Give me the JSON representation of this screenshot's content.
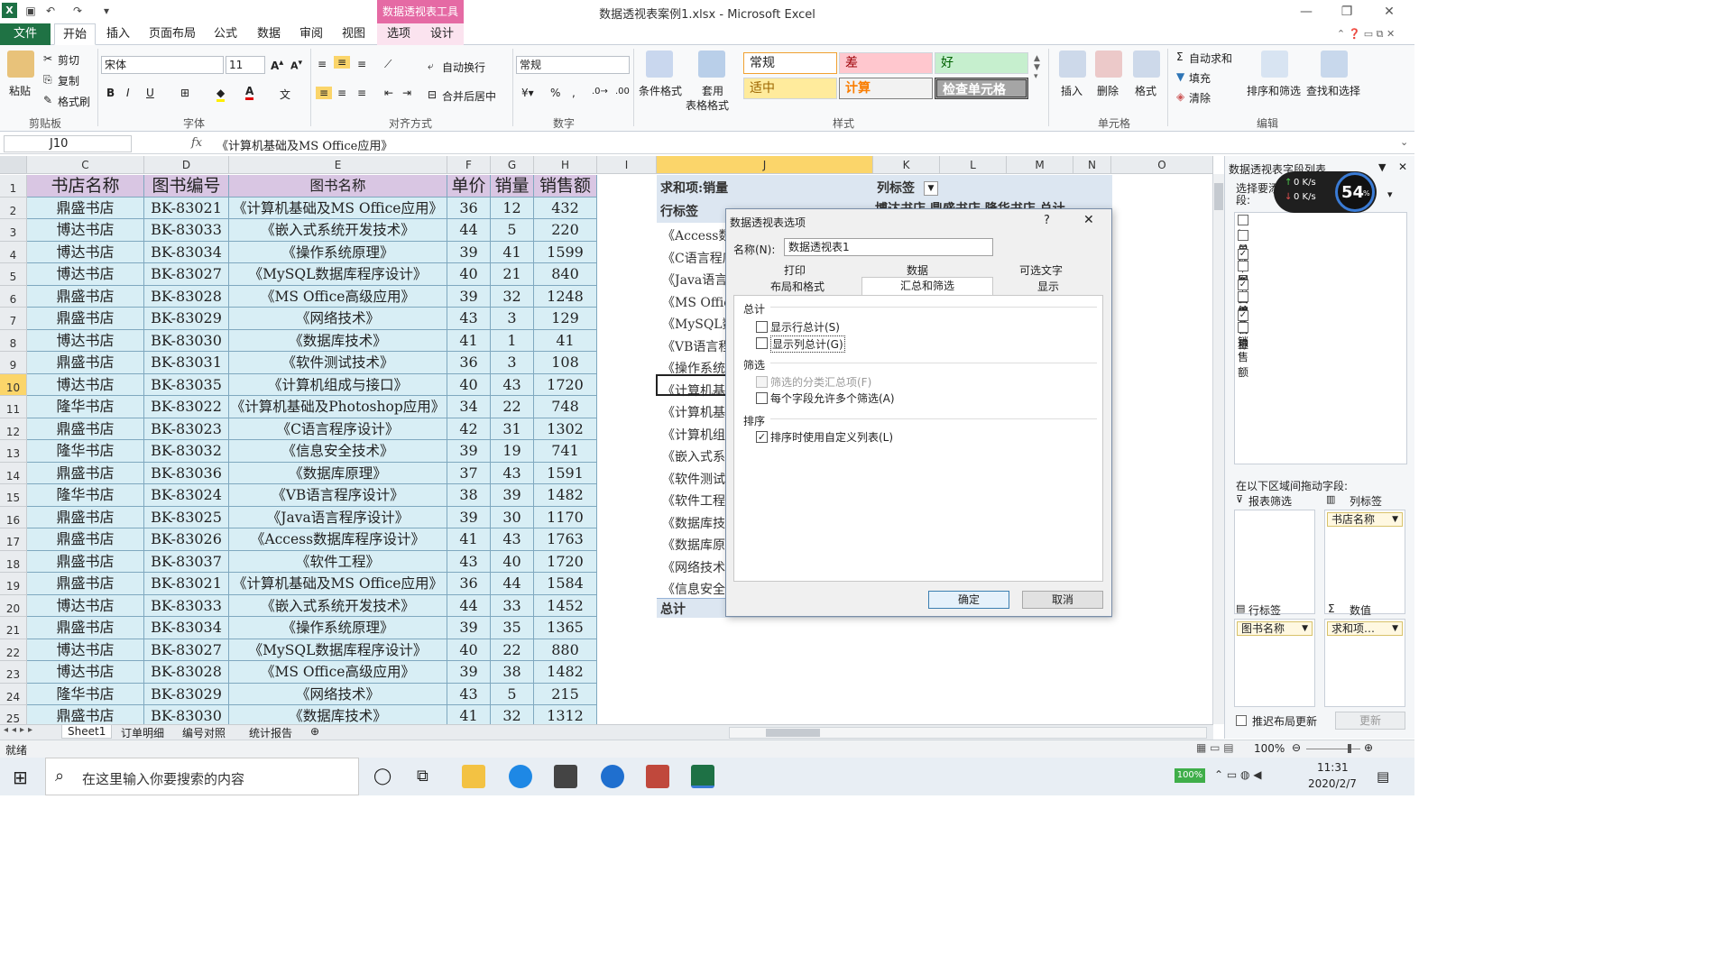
{
  "window": {
    "title": "数据透视表案例1.xlsx - Microsoft Excel",
    "context_tool": "数据透视表工具"
  },
  "tabs": [
    "文件",
    "开始",
    "插入",
    "页面布局",
    "公式",
    "数据",
    "审阅",
    "视图",
    "选项",
    "设计"
  ],
  "ribbon": {
    "clipboard": {
      "paste": "粘贴",
      "cut": "剪切",
      "copy": "复制",
      "format_painter": "格式刷",
      "label": "剪贴板"
    },
    "font": {
      "name": "宋体",
      "size": "11",
      "label": "字体"
    },
    "align": {
      "wrap": "自动换行",
      "merge": "合并后居中",
      "label": "对齐方式"
    },
    "number": {
      "format": "常规",
      "label": "数字"
    },
    "styles": {
      "cond": "条件格式",
      "table": "套用",
      "table2": "表格格式",
      "normal": "常规",
      "bad": "差",
      "good": "好",
      "neutral": "适中",
      "calc": "计算",
      "check": "检查单元格",
      "label": "样式"
    },
    "cells": {
      "insert": "插入",
      "delete": "删除",
      "format": "格式",
      "label": "单元格"
    },
    "editing": {
      "autosum": "自动求和",
      "fill": "填充",
      "clear": "清除",
      "sort": "排序和筛选",
      "find": "查找和选择",
      "label": "编辑"
    }
  },
  "formula_bar": {
    "name_box": "J10",
    "fx": "fx",
    "content": "《计算机基础及MS Office应用》"
  },
  "columns": [
    "C",
    "D",
    "E",
    "F",
    "G",
    "H",
    "I",
    "J",
    "K",
    "L",
    "M",
    "N",
    "O"
  ],
  "table": {
    "headers": [
      "书店名称",
      "图书编号",
      "图书名称",
      "单价",
      "销量",
      "销售额"
    ],
    "rows": [
      [
        "鼎盛书店",
        "BK-83021",
        "《计算机基础及MS Office应用》",
        "36",
        "12",
        "432"
      ],
      [
        "博达书店",
        "BK-83033",
        "《嵌入式系统开发技术》",
        "44",
        "5",
        "220"
      ],
      [
        "博达书店",
        "BK-83034",
        "《操作系统原理》",
        "39",
        "41",
        "1599"
      ],
      [
        "博达书店",
        "BK-83027",
        "《MySQL数据库程序设计》",
        "40",
        "21",
        "840"
      ],
      [
        "鼎盛书店",
        "BK-83028",
        "《MS Office高级应用》",
        "39",
        "32",
        "1248"
      ],
      [
        "鼎盛书店",
        "BK-83029",
        "《网络技术》",
        "43",
        "3",
        "129"
      ],
      [
        "博达书店",
        "BK-83030",
        "《数据库技术》",
        "41",
        "1",
        "41"
      ],
      [
        "鼎盛书店",
        "BK-83031",
        "《软件测试技术》",
        "36",
        "3",
        "108"
      ],
      [
        "博达书店",
        "BK-83035",
        "《计算机组成与接口》",
        "40",
        "43",
        "1720"
      ],
      [
        "隆华书店",
        "BK-83022",
        "《计算机基础及Photoshop应用》",
        "34",
        "22",
        "748"
      ],
      [
        "鼎盛书店",
        "BK-83023",
        "《C语言程序设计》",
        "42",
        "31",
        "1302"
      ],
      [
        "隆华书店",
        "BK-83032",
        "《信息安全技术》",
        "39",
        "19",
        "741"
      ],
      [
        "鼎盛书店",
        "BK-83036",
        "《数据库原理》",
        "37",
        "43",
        "1591"
      ],
      [
        "隆华书店",
        "BK-83024",
        "《VB语言程序设计》",
        "38",
        "39",
        "1482"
      ],
      [
        "鼎盛书店",
        "BK-83025",
        "《Java语言程序设计》",
        "39",
        "30",
        "1170"
      ],
      [
        "鼎盛书店",
        "BK-83026",
        "《Access数据库程序设计》",
        "41",
        "43",
        "1763"
      ],
      [
        "鼎盛书店",
        "BK-83037",
        "《软件工程》",
        "43",
        "40",
        "1720"
      ],
      [
        "鼎盛书店",
        "BK-83021",
        "《计算机基础及MS Office应用》",
        "36",
        "44",
        "1584"
      ],
      [
        "博达书店",
        "BK-83033",
        "《嵌入式系统开发技术》",
        "44",
        "33",
        "1452"
      ],
      [
        "鼎盛书店",
        "BK-83034",
        "《操作系统原理》",
        "39",
        "35",
        "1365"
      ],
      [
        "博达书店",
        "BK-83027",
        "《MySQL数据库程序设计》",
        "40",
        "22",
        "880"
      ],
      [
        "博达书店",
        "BK-83028",
        "《MS Office高级应用》",
        "39",
        "38",
        "1482"
      ],
      [
        "隆华书店",
        "BK-83029",
        "《网络技术》",
        "43",
        "5",
        "215"
      ],
      [
        "鼎盛书店",
        "BK-83030",
        "《数据库技术》",
        "41",
        "32",
        "1312"
      ]
    ]
  },
  "pivot": {
    "sum_label": "求和项:销量",
    "col_label": "列标签",
    "row_label": "行标签",
    "col_items_partial": "博达书店  鼎盛书店  隆华书店  总计",
    "rows": [
      "《Access数",
      "《C语言程序",
      "《Java语言",
      "《MS Offic",
      "《MySQL数",
      "《VB语言程",
      "《操作系统",
      "《计算机基",
      "《计算机基",
      "《计算机组",
      "《嵌入式系",
      "《软件测试",
      "《软件工程",
      "《数据库技",
      "《数据库原",
      "《网络技术",
      "《信息安全"
    ],
    "total": "总计"
  },
  "dialog": {
    "title": "数据透视表选项",
    "help": "?",
    "name_label": "名称(N):",
    "name_value": "数据透视表1",
    "tabs_row1": [
      "打印",
      "数据",
      "可选文字"
    ],
    "tabs_row2": [
      "布局和格式",
      "汇总和筛选",
      "显示"
    ],
    "sec_total": "总计",
    "show_row_total": "显示行总计(S)",
    "show_col_total": "显示列总计(G)",
    "sec_filter": "筛选",
    "filter_subtotal": "筛选的分类汇总项(F)",
    "multi_filter": "每个字段允许多个筛选(A)",
    "sec_sort": "排序",
    "custom_list": "排序时使用自定义列表(L)",
    "ok": "确定",
    "cancel": "取消"
  },
  "pane": {
    "title": "数据透视表字段列表",
    "choose": "选择要添加到报表的字段:",
    "fields": [
      {
        "name": "订单编号",
        "checked": false
      },
      {
        "name": "日期",
        "checked": false
      },
      {
        "name": "书店名称",
        "checked": true
      },
      {
        "name": "图书编号",
        "checked": false
      },
      {
        "name": "图书名称",
        "checked": true
      },
      {
        "name": "单价",
        "checked": false
      },
      {
        "name": "销量",
        "checked": true
      },
      {
        "name": "销售额",
        "checked": false
      }
    ],
    "drag_label": "在以下区域间拖动字段:",
    "report_filter": "报表筛选",
    "col_labels": "列标签",
    "col_chip": "书店名称",
    "row_labels": "行标签",
    "row_chip": "图书名称",
    "values": "数值",
    "value_chip": "求和项…",
    "defer": "推迟布局更新",
    "update": "更新"
  },
  "net_widget": {
    "up": "0  K/s",
    "down": "0  K/s",
    "pct": "54"
  },
  "sheets": [
    "Sheet1",
    "订单明细",
    "编号对照",
    "统计报告"
  ],
  "status": {
    "ready": "就绪",
    "zoom": "100%"
  },
  "taskbar": {
    "search": "在这里输入你要搜索的内容",
    "time": "11:31",
    "date": "2020/2/7",
    "battery": "100%"
  }
}
